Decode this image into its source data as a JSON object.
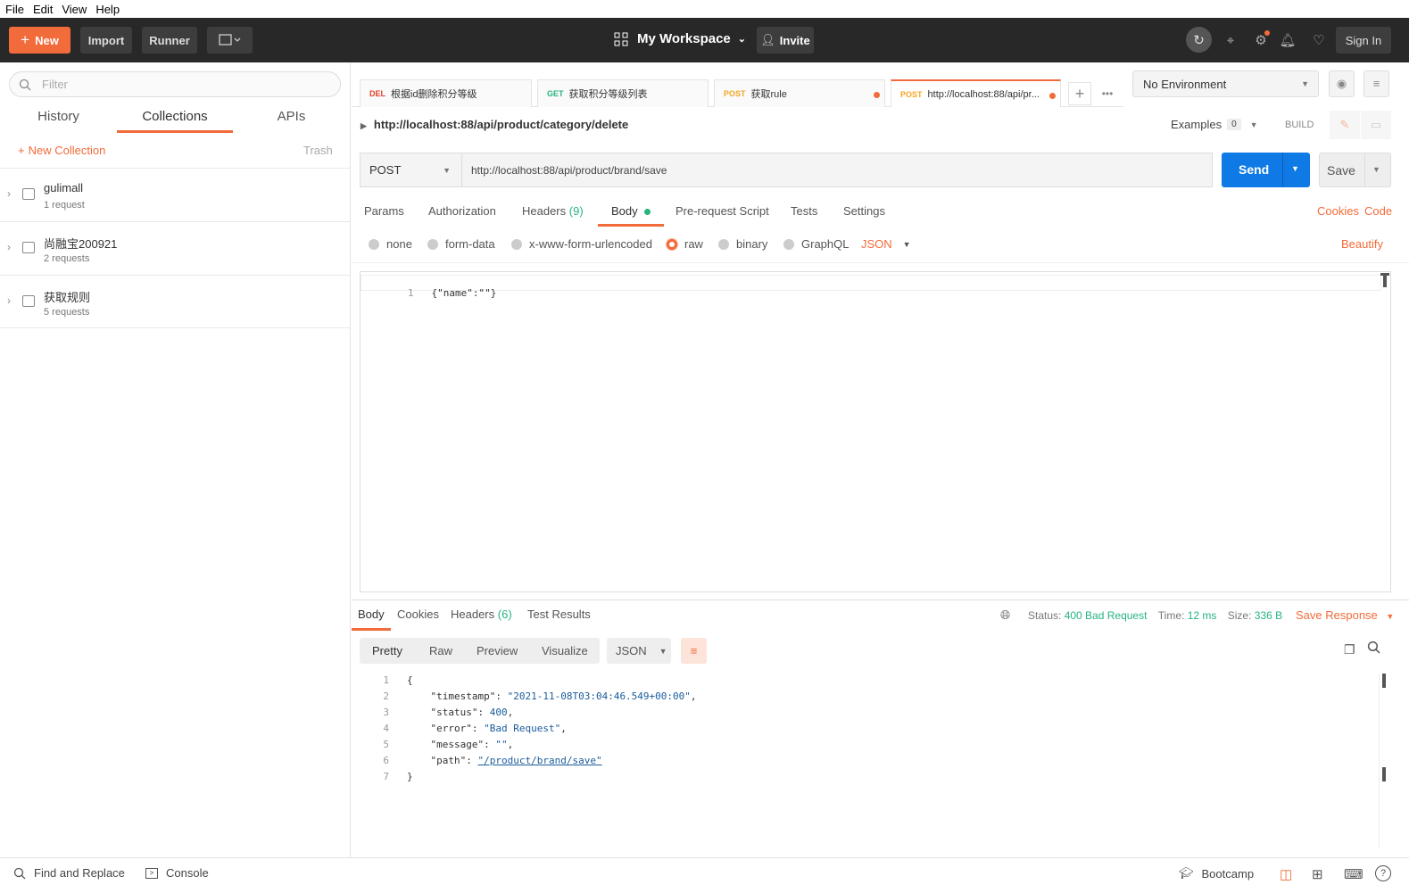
{
  "menubar": {
    "file": "File",
    "edit": "Edit",
    "view": "View",
    "help": "Help"
  },
  "header": {
    "new_label": "New",
    "import_label": "Import",
    "runner_label": "Runner",
    "workspace": "My Workspace",
    "invite_label": "Invite",
    "signin_label": "Sign In"
  },
  "sidebar": {
    "filter_placeholder": "Filter",
    "tabs": [
      "History",
      "Collections",
      "APIs"
    ],
    "new_collection": "New Collection",
    "trash": "Trash",
    "collections": [
      {
        "name": "gulimall",
        "count": "1 request"
      },
      {
        "name": "尚融宝200921",
        "count": "2 requests"
      },
      {
        "name": "获取规则",
        "count": "5 requests"
      }
    ]
  },
  "request_tabs": [
    {
      "method": "DEL",
      "method_color": "#e5402b",
      "label": "根据id删除积分等级"
    },
    {
      "method": "GET",
      "method_color": "#26b47f",
      "label": "获取积分等级列表"
    },
    {
      "method": "POST",
      "method_color": "#f5a623",
      "label": "获取rule"
    },
    {
      "method": "POST",
      "method_color": "#f5a623",
      "label": "http://localhost:88/api/pr..."
    }
  ],
  "environment": "No Environment",
  "breadcrumb": "http://localhost:88/api/product/category/delete",
  "examples_label": "Examples",
  "examples_count": "0",
  "build_label": "BUILD",
  "request": {
    "method": "POST",
    "url": "http://localhost:88/api/product/brand/save",
    "send_label": "Send",
    "save_label": "Save"
  },
  "subtabs": {
    "params": "Params",
    "authorization": "Authorization",
    "headers": "Headers",
    "headers_count": "(9)",
    "body": "Body",
    "prerequest": "Pre-request Script",
    "tests": "Tests",
    "settings": "Settings",
    "cookies": "Cookies",
    "code": "Code"
  },
  "body_options": {
    "none": "none",
    "form_data": "form-data",
    "urlencoded": "x-www-form-urlencoded",
    "raw": "raw",
    "binary": "binary",
    "graphql": "GraphQL",
    "format": "JSON",
    "beautify": "Beautify"
  },
  "editor": {
    "line_no": "1",
    "content": "{\"name\":\"\"}"
  },
  "response": {
    "tabs": {
      "body": "Body",
      "cookies": "Cookies",
      "headers": "Headers",
      "headers_count": "(6)",
      "tests": "Test Results"
    },
    "status_label": "Status:",
    "status": "400 Bad Request",
    "time_label": "Time:",
    "time": "12 ms",
    "size_label": "Size:",
    "size": "336 B",
    "save_response": "Save Response",
    "views": {
      "pretty": "Pretty",
      "raw": "Raw",
      "preview": "Preview",
      "visualize": "Visualize"
    },
    "format": "JSON",
    "lines": {
      "l1": "{",
      "timestamp_key": "\"timestamp\"",
      "timestamp_val": "\"2021-11-08T03:04:46.549+00:00\"",
      "status_key": "\"status\"",
      "status_val": "400",
      "error_key": "\"error\"",
      "error_val": "\"Bad Request\"",
      "message_key": "\"message\"",
      "message_val": "\"\"",
      "path_key": "\"path\"",
      "path_val": "\"/product/brand/save\"",
      "l7": "}"
    }
  },
  "footer": {
    "find_replace": "Find and Replace",
    "console": "Console",
    "bootcamp": "Bootcamp"
  },
  "colors": {
    "accent": "#f26b3a",
    "send": "#0f7ae5",
    "success": "#26b47f",
    "header_bg": "#282828"
  }
}
